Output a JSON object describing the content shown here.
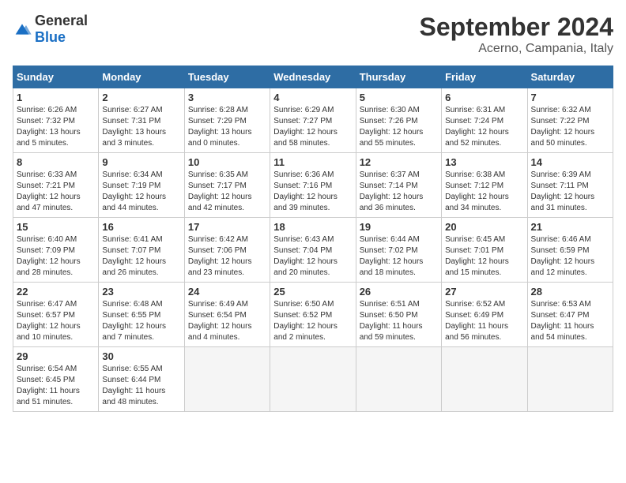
{
  "header": {
    "logo_general": "General",
    "logo_blue": "Blue",
    "month_title": "September 2024",
    "location": "Acerno, Campania, Italy"
  },
  "weekdays": [
    "Sunday",
    "Monday",
    "Tuesday",
    "Wednesday",
    "Thursday",
    "Friday",
    "Saturday"
  ],
  "weeks": [
    [
      {
        "day": "1",
        "lines": [
          "Sunrise: 6:26 AM",
          "Sunset: 7:32 PM",
          "Daylight: 13 hours",
          "and 5 minutes."
        ]
      },
      {
        "day": "2",
        "lines": [
          "Sunrise: 6:27 AM",
          "Sunset: 7:31 PM",
          "Daylight: 13 hours",
          "and 3 minutes."
        ]
      },
      {
        "day": "3",
        "lines": [
          "Sunrise: 6:28 AM",
          "Sunset: 7:29 PM",
          "Daylight: 13 hours",
          "and 0 minutes."
        ]
      },
      {
        "day": "4",
        "lines": [
          "Sunrise: 6:29 AM",
          "Sunset: 7:27 PM",
          "Daylight: 12 hours",
          "and 58 minutes."
        ]
      },
      {
        "day": "5",
        "lines": [
          "Sunrise: 6:30 AM",
          "Sunset: 7:26 PM",
          "Daylight: 12 hours",
          "and 55 minutes."
        ]
      },
      {
        "day": "6",
        "lines": [
          "Sunrise: 6:31 AM",
          "Sunset: 7:24 PM",
          "Daylight: 12 hours",
          "and 52 minutes."
        ]
      },
      {
        "day": "7",
        "lines": [
          "Sunrise: 6:32 AM",
          "Sunset: 7:22 PM",
          "Daylight: 12 hours",
          "and 50 minutes."
        ]
      }
    ],
    [
      {
        "day": "8",
        "lines": [
          "Sunrise: 6:33 AM",
          "Sunset: 7:21 PM",
          "Daylight: 12 hours",
          "and 47 minutes."
        ]
      },
      {
        "day": "9",
        "lines": [
          "Sunrise: 6:34 AM",
          "Sunset: 7:19 PM",
          "Daylight: 12 hours",
          "and 44 minutes."
        ]
      },
      {
        "day": "10",
        "lines": [
          "Sunrise: 6:35 AM",
          "Sunset: 7:17 PM",
          "Daylight: 12 hours",
          "and 42 minutes."
        ]
      },
      {
        "day": "11",
        "lines": [
          "Sunrise: 6:36 AM",
          "Sunset: 7:16 PM",
          "Daylight: 12 hours",
          "and 39 minutes."
        ]
      },
      {
        "day": "12",
        "lines": [
          "Sunrise: 6:37 AM",
          "Sunset: 7:14 PM",
          "Daylight: 12 hours",
          "and 36 minutes."
        ]
      },
      {
        "day": "13",
        "lines": [
          "Sunrise: 6:38 AM",
          "Sunset: 7:12 PM",
          "Daylight: 12 hours",
          "and 34 minutes."
        ]
      },
      {
        "day": "14",
        "lines": [
          "Sunrise: 6:39 AM",
          "Sunset: 7:11 PM",
          "Daylight: 12 hours",
          "and 31 minutes."
        ]
      }
    ],
    [
      {
        "day": "15",
        "lines": [
          "Sunrise: 6:40 AM",
          "Sunset: 7:09 PM",
          "Daylight: 12 hours",
          "and 28 minutes."
        ]
      },
      {
        "day": "16",
        "lines": [
          "Sunrise: 6:41 AM",
          "Sunset: 7:07 PM",
          "Daylight: 12 hours",
          "and 26 minutes."
        ]
      },
      {
        "day": "17",
        "lines": [
          "Sunrise: 6:42 AM",
          "Sunset: 7:06 PM",
          "Daylight: 12 hours",
          "and 23 minutes."
        ]
      },
      {
        "day": "18",
        "lines": [
          "Sunrise: 6:43 AM",
          "Sunset: 7:04 PM",
          "Daylight: 12 hours",
          "and 20 minutes."
        ]
      },
      {
        "day": "19",
        "lines": [
          "Sunrise: 6:44 AM",
          "Sunset: 7:02 PM",
          "Daylight: 12 hours",
          "and 18 minutes."
        ]
      },
      {
        "day": "20",
        "lines": [
          "Sunrise: 6:45 AM",
          "Sunset: 7:01 PM",
          "Daylight: 12 hours",
          "and 15 minutes."
        ]
      },
      {
        "day": "21",
        "lines": [
          "Sunrise: 6:46 AM",
          "Sunset: 6:59 PM",
          "Daylight: 12 hours",
          "and 12 minutes."
        ]
      }
    ],
    [
      {
        "day": "22",
        "lines": [
          "Sunrise: 6:47 AM",
          "Sunset: 6:57 PM",
          "Daylight: 12 hours",
          "and 10 minutes."
        ]
      },
      {
        "day": "23",
        "lines": [
          "Sunrise: 6:48 AM",
          "Sunset: 6:55 PM",
          "Daylight: 12 hours",
          "and 7 minutes."
        ]
      },
      {
        "day": "24",
        "lines": [
          "Sunrise: 6:49 AM",
          "Sunset: 6:54 PM",
          "Daylight: 12 hours",
          "and 4 minutes."
        ]
      },
      {
        "day": "25",
        "lines": [
          "Sunrise: 6:50 AM",
          "Sunset: 6:52 PM",
          "Daylight: 12 hours",
          "and 2 minutes."
        ]
      },
      {
        "day": "26",
        "lines": [
          "Sunrise: 6:51 AM",
          "Sunset: 6:50 PM",
          "Daylight: 11 hours",
          "and 59 minutes."
        ]
      },
      {
        "day": "27",
        "lines": [
          "Sunrise: 6:52 AM",
          "Sunset: 6:49 PM",
          "Daylight: 11 hours",
          "and 56 minutes."
        ]
      },
      {
        "day": "28",
        "lines": [
          "Sunrise: 6:53 AM",
          "Sunset: 6:47 PM",
          "Daylight: 11 hours",
          "and 54 minutes."
        ]
      }
    ],
    [
      {
        "day": "29",
        "lines": [
          "Sunrise: 6:54 AM",
          "Sunset: 6:45 PM",
          "Daylight: 11 hours",
          "and 51 minutes."
        ]
      },
      {
        "day": "30",
        "lines": [
          "Sunrise: 6:55 AM",
          "Sunset: 6:44 PM",
          "Daylight: 11 hours",
          "and 48 minutes."
        ]
      },
      {
        "day": "",
        "lines": []
      },
      {
        "day": "",
        "lines": []
      },
      {
        "day": "",
        "lines": []
      },
      {
        "day": "",
        "lines": []
      },
      {
        "day": "",
        "lines": []
      }
    ]
  ]
}
